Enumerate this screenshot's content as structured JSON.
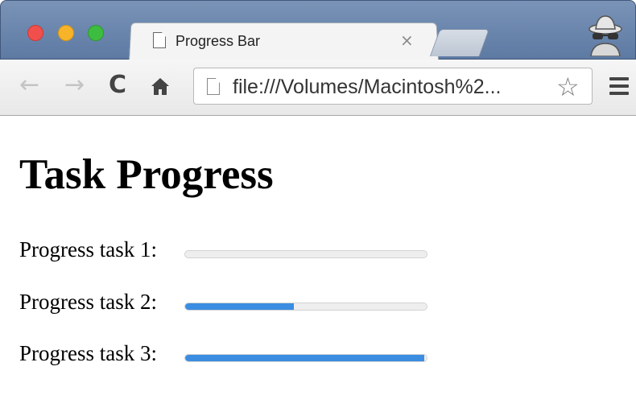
{
  "browser": {
    "tab_title": "Progress Bar",
    "tab_close": "×",
    "address": "file:///Volumes/Macintosh%2...",
    "icons": {
      "back": "back-arrow-icon",
      "forward": "forward-arrow-icon",
      "reload": "reload-icon",
      "home": "home-icon",
      "star": "bookmark-star-icon",
      "menu": "hamburger-menu-icon",
      "incognito": "incognito-icon"
    }
  },
  "page": {
    "title": "Task Progress",
    "tasks": [
      {
        "label": "Progress task 1:",
        "progress": 0
      },
      {
        "label": "Progress task 2:",
        "progress": 0.45
      },
      {
        "label": "Progress task 3:",
        "progress": 0.99
      }
    ],
    "colors": {
      "progress_fill": "#3b8de2",
      "progress_track": "#eeeeee"
    }
  }
}
